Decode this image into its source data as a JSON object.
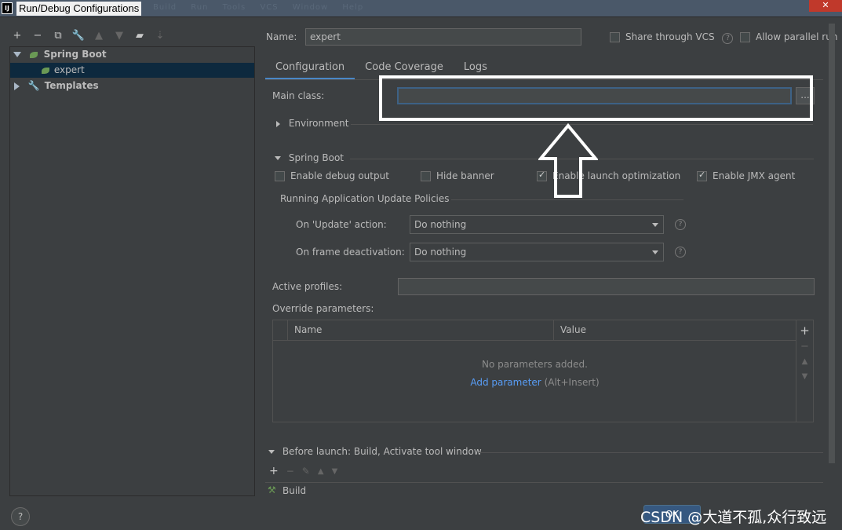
{
  "window": {
    "title": "Run/Debug Configurations",
    "logo": "IJ",
    "ghost_menu": "Build Run Tools VCS Window Help",
    "close_glyph": "✕"
  },
  "toolbar": {
    "icons": [
      "plus-icon",
      "minus-icon",
      "copy-icon",
      "wrench-icon",
      "arrow-up-icon",
      "arrow-down-icon",
      "folder-icon",
      "sort-icon"
    ],
    "glyphs": [
      "+",
      "−",
      "⧉",
      "🔧",
      "▲",
      "▼",
      "▰",
      "⇣"
    ]
  },
  "tree": {
    "group": "Spring Boot",
    "child": "expert",
    "templates": "Templates"
  },
  "name_label": "Name:",
  "name_value": "expert",
  "share_vcs": "Share through VCS",
  "allow_parallel": "Allow parallel run",
  "tabs": [
    "Configuration",
    "Code Coverage",
    "Logs"
  ],
  "main_class_label": "Main class:",
  "main_class_value": "",
  "browse_label": "...",
  "environment": "Environment",
  "spring_boot_section": "Spring Boot",
  "options": {
    "enable_debug": "Enable debug output",
    "hide_banner": "Hide banner",
    "launch_opt": "Enable launch optimization",
    "jmx": "Enable JMX agent"
  },
  "policies_header": "Running Application Update Policies",
  "update_action_label": "On 'Update' action:",
  "update_action_value": "Do nothing",
  "frame_deactivation_label": "On frame deactivation:",
  "frame_deactivation_value": "Do nothing",
  "active_profiles_label": "Active profiles:",
  "override_label": "Override parameters:",
  "table": {
    "col_name": "Name",
    "col_value": "Value",
    "empty": "No parameters added.",
    "add_link": "Add parameter",
    "add_shortcut": "(Alt+Insert)"
  },
  "before_launch": "Before launch: Build, Activate tool window",
  "build_item": "Build",
  "watermark": "CSDN @大道不孤,众行致远",
  "ok_button": "OK",
  "help_glyph": "?"
}
